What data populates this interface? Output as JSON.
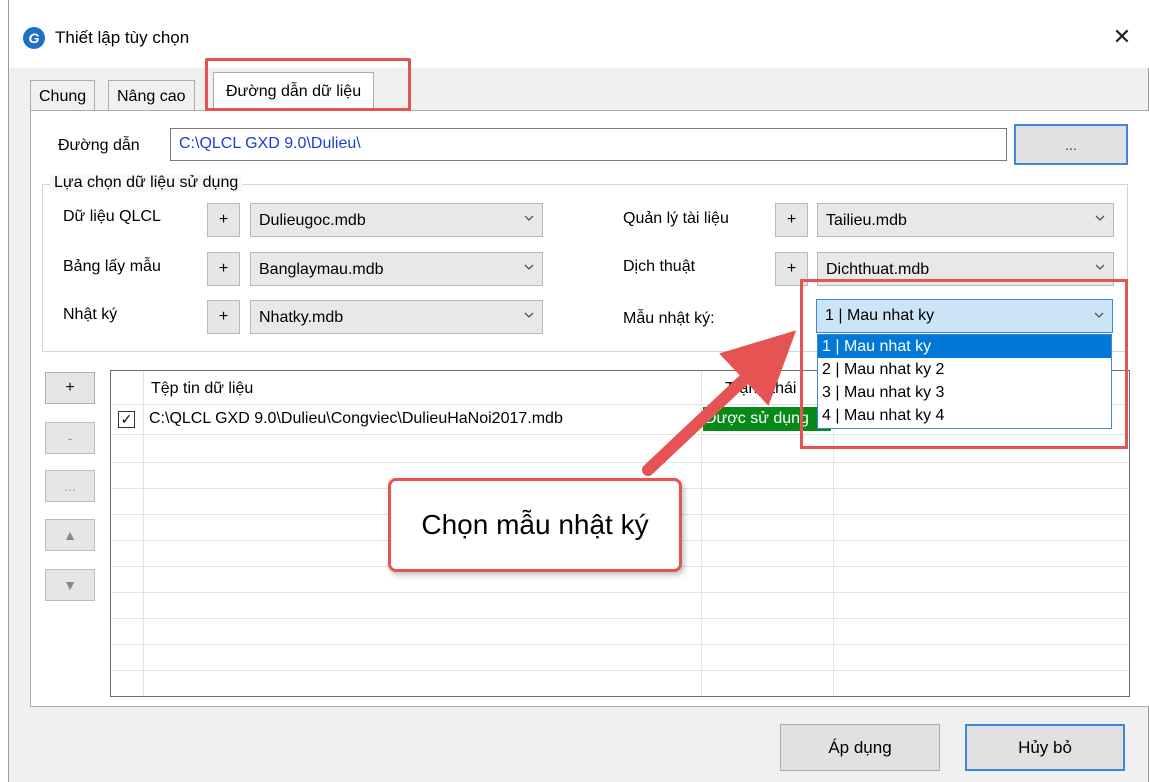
{
  "window": {
    "title": "Thiết lập tùy chọn",
    "close_glyph": "✕",
    "app_icon": "app-logo-icon"
  },
  "tabs": [
    "Chung",
    "Nâng cao",
    "Đường dẫn dữ liệu"
  ],
  "path": {
    "label": "Đường dẫn",
    "value": "C:\\QLCL GXD 9.0\\Dulieu\\",
    "browse_label": "..."
  },
  "group": {
    "title": "Lựa chọn dữ liệu sử dụng",
    "plus_label": "+",
    "fields": {
      "qlcl": {
        "label": "Dữ liệu QLCL",
        "value": "Dulieugoc.mdb"
      },
      "banglaymau": {
        "label": "Bảng lấy mẫu",
        "value": "Banglaymau.mdb"
      },
      "nhatky": {
        "label": "Nhật ký",
        "value": "Nhatky.mdb"
      },
      "tailieu": {
        "label": "Quản lý tài liệu",
        "value": "Tailieu.mdb"
      },
      "dichthuat": {
        "label": "Dịch thuật",
        "value": "Dichthuat.mdb"
      },
      "maunhatky": {
        "label": "Mẫu nhật ký:",
        "value": "1 | Mau nhat ky"
      }
    }
  },
  "dropdown": {
    "options": [
      "1 | Mau nhat ky",
      "2 | Mau nhat ky 2",
      "3 | Mau nhat ky 3",
      "4 | Mau nhat ky 4"
    ]
  },
  "side_buttons": {
    "add": "+",
    "remove": "-",
    "more": "...",
    "up": "▲",
    "down": "▼"
  },
  "grid": {
    "headers": {
      "file": "Tệp tin dữ liệu",
      "status": "Trạng thái"
    },
    "rows": [
      {
        "checked": "✓",
        "file": "C:\\QLCL GXD 9.0\\Dulieu\\Congviec\\DulieuHaNoi2017.mdb",
        "status": "Được sử dụng"
      }
    ]
  },
  "callout": {
    "text": "Chọn mẫu nhật ký"
  },
  "footer": {
    "apply": "Áp dụng",
    "cancel": "Hủy bỏ"
  },
  "colors": {
    "accent": "#3d86d9",
    "highlight": "#e55353",
    "status_green": "#078a17",
    "selection": "#0078d7"
  }
}
